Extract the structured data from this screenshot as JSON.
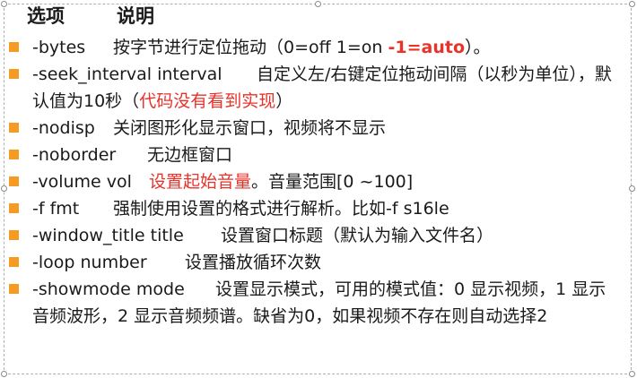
{
  "header": {
    "col_option": "选项",
    "col_desc": "说明"
  },
  "items": [
    {
      "option": "-bytes",
      "desc_a": "按字节进行定位拖动（0=off 1=on ",
      "desc_red": "-1=auto",
      "desc_b": "）。"
    },
    {
      "option": "-seek_interval interval",
      "desc_a": "自定义左/右键定位拖动间隔（以秒为单位），默认值为10秒（",
      "desc_red": "代码没有看到实现",
      "desc_b": "）"
    },
    {
      "option": "-nodisp",
      "desc_a": "关闭图形化显示窗口，视频将不显示"
    },
    {
      "option": "-noborder",
      "desc_a": "无边框窗口"
    },
    {
      "option": "-volume vol",
      "desc_red": "设置起始音量",
      "desc_b": "。音量范围[0 ~100]"
    },
    {
      "option": "-f fmt",
      "desc_a": "强制使用设置的格式进行解析。比如-f s16le"
    },
    {
      "option": "-window_title title",
      "desc_a": "设置窗口标题（默认为输入文件名）"
    },
    {
      "option": "-loop number",
      "desc_a": "设置播放循环次数"
    },
    {
      "option": "-showmode mode",
      "desc_a": "设置显示模式，可用的模式值：0 显示视频，1 显示音频波形，2 显示音频频谱。缺省为0，如果视频不存在则自动选择2"
    }
  ],
  "colors": {
    "bullet": "#f59a23",
    "highlight": "#e8322a"
  }
}
